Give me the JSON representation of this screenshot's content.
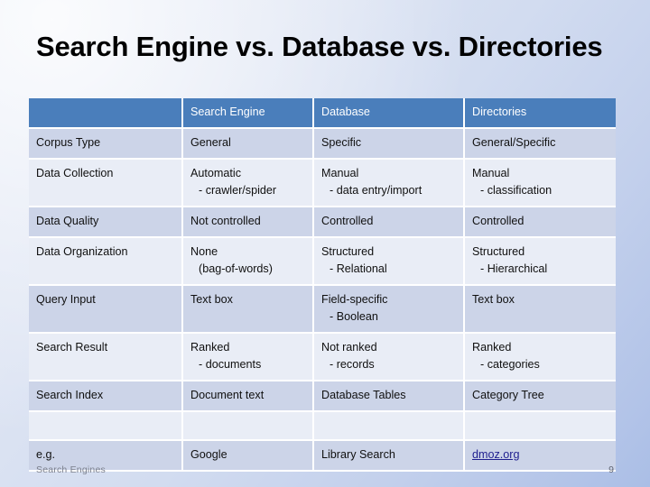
{
  "slide": {
    "title": "Search Engine vs. Database vs. Directories",
    "footer_label": "Search Engines",
    "page_number": "9",
    "accent_header_color": "#4a7ebb",
    "row_dark_color": "#ccd4e8",
    "row_light_color": "#e9edf6",
    "link_color": "#1f1f8f"
  },
  "table": {
    "headers": {
      "corner": "",
      "col1": "Search Engine",
      "col2": "Database",
      "col3": "Directories"
    },
    "rows": [
      {
        "label": "Corpus Type",
        "search_engine": "General",
        "search_engine_sub": "",
        "database": "Specific",
        "database_sub": "",
        "directories": "General/Specific",
        "directories_sub": ""
      },
      {
        "label": "Data Collection",
        "search_engine": "Automatic",
        "search_engine_sub": "- crawler/spider",
        "database": "Manual",
        "database_sub": "- data entry/import",
        "directories": "Manual",
        "directories_sub": "- classification"
      },
      {
        "label": "Data Quality",
        "search_engine": "Not controlled",
        "search_engine_sub": "",
        "database": "Controlled",
        "database_sub": "",
        "directories": "Controlled",
        "directories_sub": ""
      },
      {
        "label": "Data Organization",
        "search_engine": "None",
        "search_engine_sub": "(bag-of-words)",
        "database": "Structured",
        "database_sub": "- Relational",
        "directories": "Structured",
        "directories_sub": "- Hierarchical"
      },
      {
        "label": "Query Input",
        "search_engine": "Text box",
        "search_engine_sub": "",
        "database": "Field-specific",
        "database_sub": "- Boolean",
        "directories": "Text box",
        "directories_sub": ""
      },
      {
        "label": "Search Result",
        "search_engine": "Ranked",
        "search_engine_sub": "- documents",
        "database": "Not ranked",
        "database_sub": "- records",
        "directories": "Ranked",
        "directories_sub": "- categories"
      },
      {
        "label": "Search Index",
        "search_engine": "Document text",
        "search_engine_sub": "",
        "database": "Database Tables",
        "database_sub": "",
        "directories": "Category Tree",
        "directories_sub": ""
      },
      {
        "label": "",
        "search_engine": "",
        "search_engine_sub": "",
        "database": "",
        "database_sub": "",
        "directories": "",
        "directories_sub": ""
      },
      {
        "label": "e.g.",
        "search_engine": "Google",
        "search_engine_sub": "",
        "database": "Library Search",
        "database_sub": "",
        "directories": "dmoz.org",
        "directories_sub": ""
      }
    ]
  }
}
